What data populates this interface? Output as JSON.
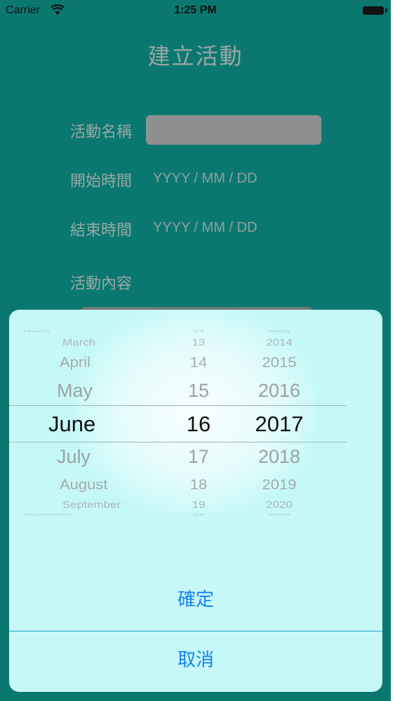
{
  "status_bar": {
    "carrier": "Carrier",
    "time": "1:25 PM",
    "icons": [
      "wifi-icon",
      "battery-icon"
    ]
  },
  "page": {
    "title": "建立活動"
  },
  "form": {
    "name_label": "活動名稱",
    "name_value": "",
    "start_label": "開始時間",
    "start_placeholder": "YYYY / MM / DD",
    "end_label": "結束時間",
    "end_placeholder": "YYYY / MM / DD",
    "content_label": "活動內容"
  },
  "date_picker": {
    "months": [
      "March",
      "April",
      "May",
      "June",
      "July",
      "August",
      "September"
    ],
    "days": [
      "13",
      "14",
      "15",
      "16",
      "17",
      "18",
      "19"
    ],
    "years": [
      "2014",
      "2015",
      "2016",
      "2017",
      "2018",
      "2019",
      "2020"
    ],
    "selected": {
      "month": "June",
      "day": "16",
      "year": "2017"
    }
  },
  "actions": {
    "confirm_label": "確定",
    "cancel_label": "取消"
  },
  "colors": {
    "background": "#0b7870",
    "sheet": "#c7f8f8",
    "action_text": "#1582f0"
  }
}
